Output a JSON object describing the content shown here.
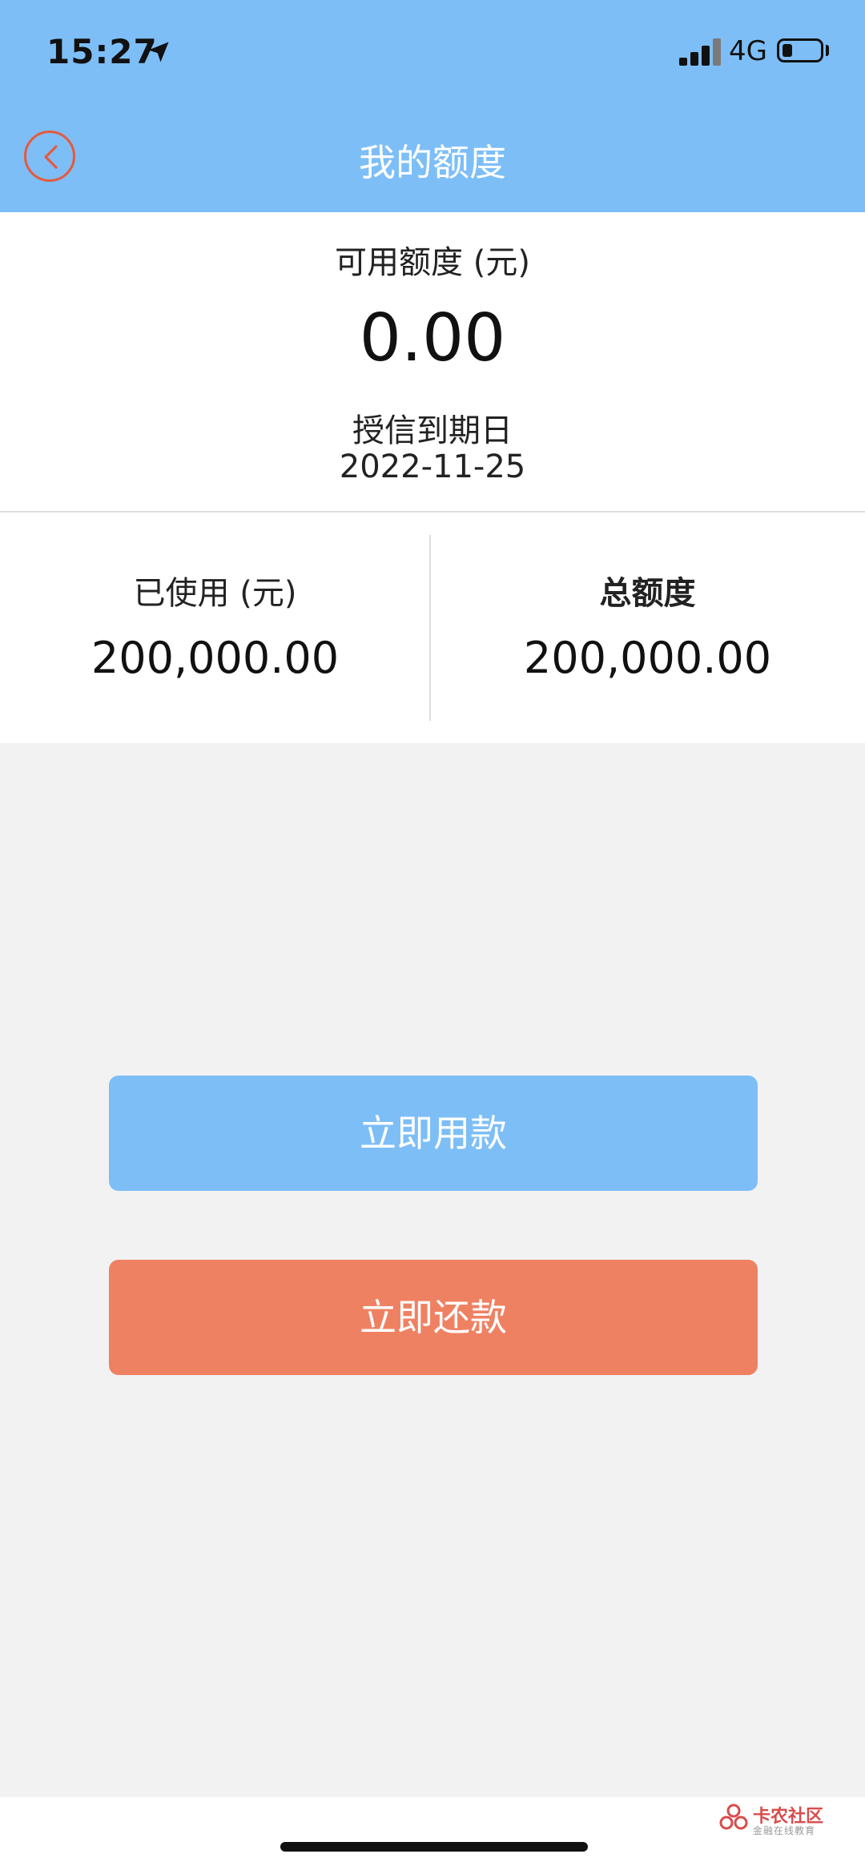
{
  "status_bar": {
    "time": "15:27",
    "network": "4G"
  },
  "nav": {
    "title": "我的额度"
  },
  "available": {
    "label": "可用额度 (元)",
    "amount": "0.00",
    "expiry_label": "授信到期日",
    "expiry_date": "2022-11-25"
  },
  "stats": {
    "used_label": "已使用 (元)",
    "used_amount": "200,000.00",
    "total_label": "总额度",
    "total_amount": "200,000.00"
  },
  "actions": {
    "use_label": "立即用款",
    "repay_label": "立即还款"
  },
  "watermark": {
    "name": "卡农社区",
    "subtitle": "金融在线教育"
  },
  "colors": {
    "primary": "#7dbef7",
    "accent": "#ef8163",
    "back_icon": "#e55a3c"
  },
  "icons": {
    "back": "chevron-left-icon",
    "location": "location-arrow-icon",
    "signal": "signal-icon",
    "battery": "battery-icon"
  }
}
